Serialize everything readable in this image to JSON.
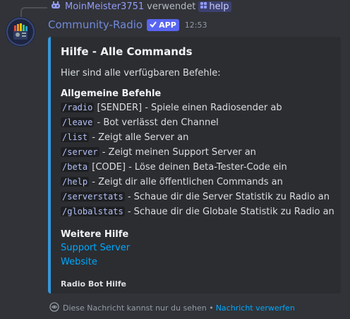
{
  "reply": {
    "username": "MoinMeister3751",
    "verb": "verwendet",
    "command": "help"
  },
  "message": {
    "author": "Community-Radio",
    "app_tag": "APP",
    "timestamp": "12:53"
  },
  "embed": {
    "title": "Hilfe - Alle Commands",
    "description": "Hier sind alle verfügbaren Befehle:",
    "general_section": {
      "name": "Allgemeine Befehle",
      "commands": [
        {
          "cmd": "/radio",
          "text": " [SENDER] - Spiele einen Radiosender ab"
        },
        {
          "cmd": "/leave",
          "text": " - Bot verlässt den Channel"
        },
        {
          "cmd": "/list",
          "text": " - Zeigt alle Server an"
        },
        {
          "cmd": "/server",
          "text": " - Zeigt meinen Support Server an"
        },
        {
          "cmd": "/beta",
          "text": " [CODE] - Löse deinen Beta-Tester-Code ein"
        },
        {
          "cmd": "/help",
          "text": " - Zeigt dir alle öffentlichen Commands an"
        },
        {
          "cmd": "/serverstats",
          "text": " - Schaue dir die Server Statistik zu Radio an"
        },
        {
          "cmd": "/globalstats",
          "text": " - Schaue dir die Globale Statistik zu Radio an"
        }
      ]
    },
    "more_section": {
      "name": "Weitere Hilfe",
      "links": [
        "Support Server",
        "Website"
      ]
    },
    "footer": "Radio Bot Hilfe",
    "accent_color": "#3498db"
  },
  "ephemeral": {
    "notice": "Diese Nachricht kannst nur du sehen •",
    "dismiss": "Nachricht verwerfen"
  }
}
